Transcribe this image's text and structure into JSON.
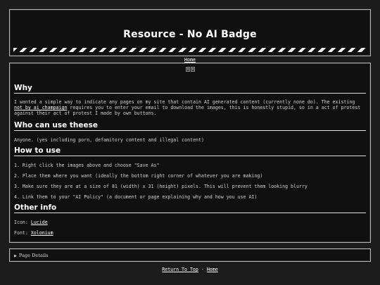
{
  "header": {
    "title": "Resource - No AI Badge",
    "home_link": "Home"
  },
  "badges": {
    "count": 2
  },
  "sections": {
    "why": {
      "title": "Why",
      "text_before": "I wanted a simple way to indicate any pages on my site that contain AI generated content (currently none do). The existing",
      "link": "not by ai champaign",
      "text_after": "requires you to enter your email to download the images, this is honestly stupid, so in a act of protest against their act of protest I made by own buttons."
    },
    "who": {
      "title": "Who can use theese",
      "text": "Anyone. (yes including porn, defamitory content and illegal content)"
    },
    "how": {
      "title": "How to use",
      "steps": [
        "1. Right click the images above and choose \"Save As\"",
        "2. Place them where you want (ideally the bottom right corner of whatever you are making)",
        "3. Make sure they are at a size of 81 (width) x 31 (height) pixels. This will prevent them looking blurry",
        "4. Link them to your \"AI Policy\" (a document or page explaining why and how you use AI)"
      ]
    },
    "other": {
      "title": "Other info",
      "icon_label": "Icon:",
      "icon_link": "Lucide",
      "font_label": "Font:",
      "font_link": "Xolonium"
    }
  },
  "details": {
    "summary": "Page Details"
  },
  "footer": {
    "return_link": "Return To Top",
    "separator": "-",
    "home_link": "Home"
  },
  "colors": {
    "background": "#1c1c1c",
    "panel": "#101010",
    "border": "#b8b8b8",
    "text": "#d8d8d8",
    "heading": "#ffffff"
  }
}
